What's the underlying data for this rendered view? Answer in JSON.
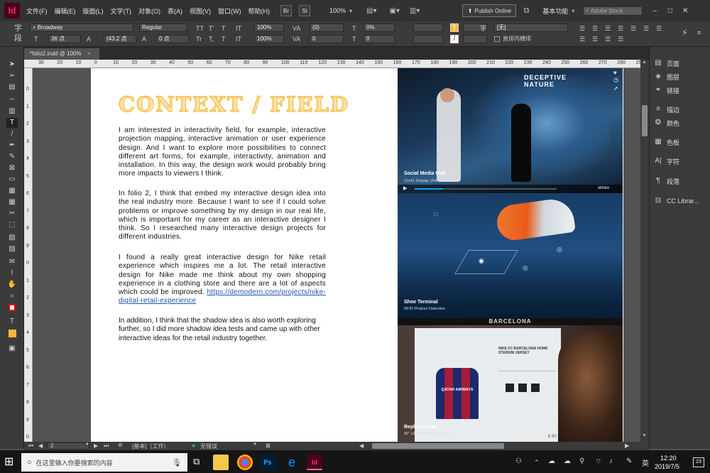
{
  "app": {
    "logo": "Id",
    "menus": [
      "文件(F)",
      "编辑(E)",
      "版面(L)",
      "文字(T)",
      "对象(O)",
      "表(A)",
      "视图(V)",
      "窗口(W)",
      "帮助(H)"
    ],
    "toolbar_btns": [
      "Br",
      "St"
    ],
    "zoom": "100%",
    "publish_label": "Publish Online",
    "workspace": "基本功能",
    "search_placeholder": "Adobe Stock",
    "window_controls": [
      "–",
      "□",
      "✕"
    ]
  },
  "control_panel": {
    "font_family": "Broadway",
    "font_style": "Regular",
    "font_size": "36 点",
    "leading": "(43.2 点",
    "kerning": "(0)",
    "tracking": "0",
    "scale_v": "100%",
    "scale_h": "100%",
    "baseline": "0 点",
    "skew": "0°",
    "tint": "0%",
    "zero2": "0",
    "char_style": "[无]",
    "char_style_label": "字",
    "vertical_label": "直排内横排",
    "text_buttons": [
      "TT",
      "T'",
      "T",
      "Tr",
      "T,",
      "T"
    ],
    "tt_icons": [
      "IT",
      "IT"
    ]
  },
  "doc_tab": {
    "label": "*folio2.indd @ 100%",
    "close": "×"
  },
  "ruler": {
    "h_ticks": [
      "30",
      "20",
      "10",
      "0",
      "10",
      "20",
      "30",
      "40",
      "50",
      "60",
      "70",
      "80",
      "90",
      "100",
      "110",
      "120",
      "130",
      "140",
      "150",
      "160",
      "170",
      "180",
      "190",
      "200",
      "210",
      "220",
      "230",
      "240",
      "250",
      "260",
      "270",
      "280",
      "290"
    ],
    "v_ticks": [
      "0",
      "1",
      "2",
      "3",
      "4",
      "5",
      "6",
      "7",
      "8",
      "9",
      "0",
      "1",
      "2",
      "3",
      "4",
      "5",
      "6",
      "7",
      "8",
      "9",
      "0"
    ]
  },
  "page": {
    "title": "CONTEXT / FIELD",
    "p1": "I am interested in interactivity field, for example, interactive projection mapping, interactive animation or user experience design. And I want to explore more possibilities to connect different art forms, for example, interactivity, animation and installation. In this way,  the design work would probably bring more impacts to viewers I think.",
    "p2": "In folio 2, I think that embed my interactive design idea into the real industry more. Because I want to see if I could solve problems or improve something by my design in our real life, which is important for my career as an interactive designer I think. So I researched many interactive design projects for different industries.",
    "p3": "I found a really great interactive design for Nike retail experience which inspires me a lot. The retail interactive design for Nike made me think about my own shopping experience in a clothing store and there are a lot of aspects which could be improved.",
    "p3_link": "https://demodern.com/projects/nike-digital-retail-experience",
    "p4": "In addition, I think that the shadow idea is also worth exploring further, so I did more shadow idea tests and came up with other interactive ideas for the retail industry together.",
    "images": [
      {
        "caption": "Social Media Wall",
        "sub": "12x41 Display, UHD Resolution",
        "overlay": "DECEPTIVE NATURE",
        "player": "vimeo"
      },
      {
        "caption": "Shoe Terminal",
        "sub": "RFID Product Detection"
      },
      {
        "caption": "Replica Kiosk",
        "sub": "65\" UHD Multitouch Display",
        "overlay": "BARCELONA",
        "kiosk_text": "NIKE FC BARCELONA HOME STADIUM JERSEY",
        "price": "€ 90",
        "jersey": "QATAR AIRWAYS"
      }
    ]
  },
  "status": {
    "page_num": "2",
    "master": "[基本]（工作）",
    "errors": "无错误"
  },
  "right_panel": {
    "items": [
      "页面",
      "图层",
      "链接",
      "描边",
      "颜色",
      "色板",
      "字符",
      "段落",
      "CC Librar..."
    ]
  },
  "taskbar": {
    "search_placeholder": "在这里输入你要搜索的内容",
    "time": "12:20",
    "date": "2019/7/5",
    "ime": "英",
    "notification_count": "23",
    "app_ps": "Ps",
    "app_id": "Id"
  }
}
